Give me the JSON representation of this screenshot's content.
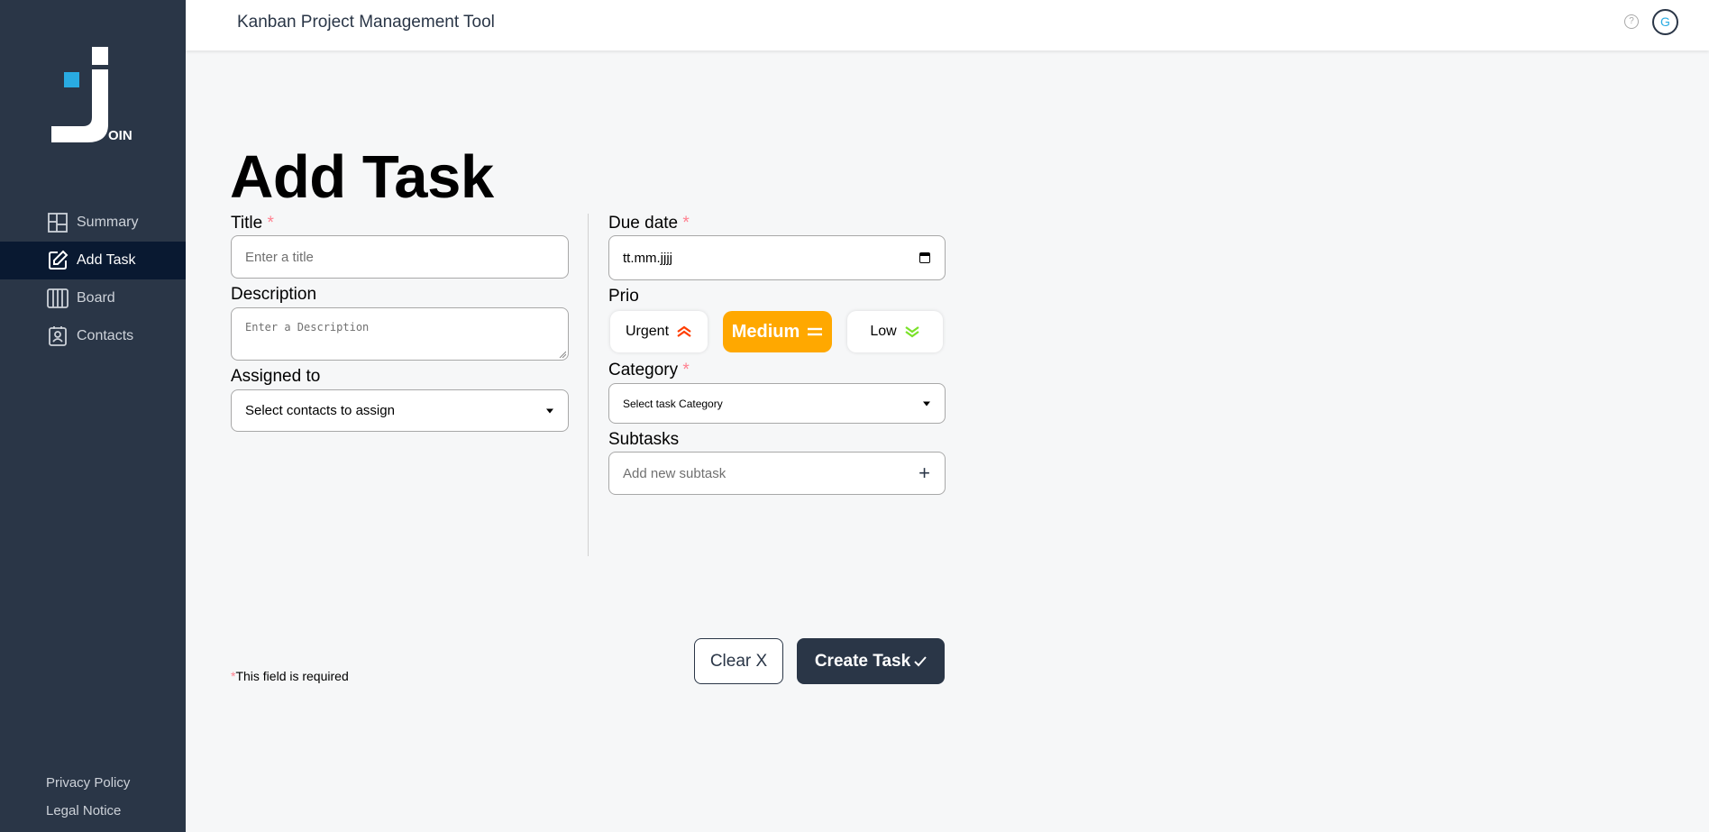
{
  "app": {
    "header_title": "Kanban Project Management Tool",
    "help_icon": "?",
    "avatar_initial": "G",
    "logo_text": "OIN"
  },
  "sidebar": {
    "items": [
      {
        "label": "Summary",
        "icon": "summary-icon",
        "active": false
      },
      {
        "label": "Add Task",
        "icon": "edit-icon",
        "active": true
      },
      {
        "label": "Board",
        "icon": "board-icon",
        "active": false
      },
      {
        "label": "Contacts",
        "icon": "contacts-icon",
        "active": false
      }
    ],
    "footer_links": [
      "Privacy Policy",
      "Legal Notice"
    ]
  },
  "form": {
    "page_title": "Add Task",
    "required_mark": "*",
    "title": {
      "label": "Title",
      "placeholder": "Enter a title"
    },
    "description": {
      "label": "Description",
      "placeholder": "Enter a Description"
    },
    "assigned": {
      "label": "Assigned to",
      "placeholder": "Select contacts to assign"
    },
    "due_date": {
      "label": "Due date",
      "value": "tt.mm.jjjj"
    },
    "prio": {
      "label": "Prio",
      "options": [
        "Urgent",
        "Medium",
        "Low"
      ],
      "selected": "Medium"
    },
    "category": {
      "label": "Category",
      "placeholder": "Select task Category"
    },
    "subtasks": {
      "label": "Subtasks",
      "placeholder": "Add new subtask"
    },
    "required_note": "This field is required",
    "clear_label": "Clear X",
    "create_label": "Create Task"
  },
  "colors": {
    "sidebar": "#2a3647",
    "active_nav": "#091931",
    "medium": "#ffa800",
    "urgent": "#ff3d00",
    "low": "#7ae229",
    "required": "#ff8190",
    "logo_accent": "#29abe2"
  }
}
